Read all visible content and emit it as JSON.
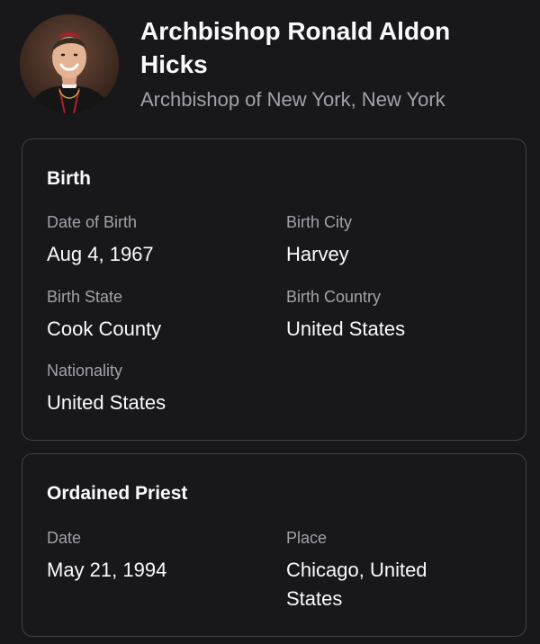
{
  "profile": {
    "name": "Archbishop Ronald Aldon Hicks",
    "title": "Archbishop of New York, New York",
    "avatar_icon": "portrait-photo"
  },
  "birth": {
    "heading": "Birth",
    "fields": [
      {
        "label": "Date of Birth",
        "value": "Aug 4, 1967"
      },
      {
        "label": "Birth City",
        "value": "Harvey"
      },
      {
        "label": "Birth State",
        "value": "Cook County"
      },
      {
        "label": "Birth Country",
        "value": "United States"
      },
      {
        "label": "Nationality",
        "value": "United States"
      }
    ]
  },
  "ordained_priest": {
    "heading": "Ordained Priest",
    "fields": [
      {
        "label": "Date",
        "value": "May 21, 1994"
      },
      {
        "label": "Place",
        "value": "Chicago, United States"
      }
    ]
  },
  "colors": {
    "background": "#18181b",
    "card_border": "#3f3f46",
    "text_primary": "#fafafa",
    "text_secondary": "#a1a1aa"
  }
}
